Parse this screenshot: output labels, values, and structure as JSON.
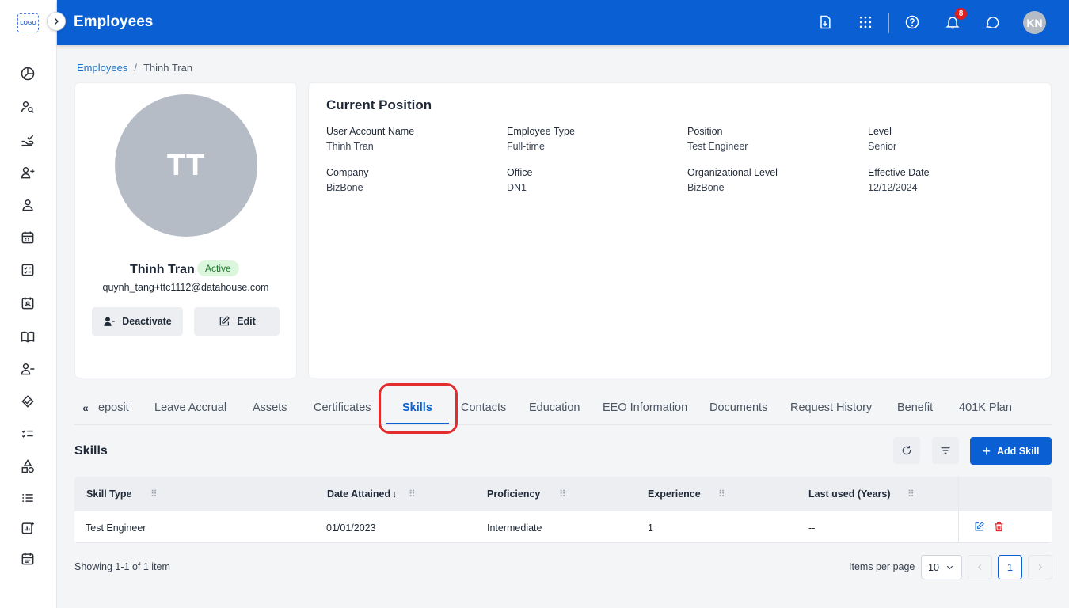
{
  "app": {
    "logo_text": "LOGO",
    "header_title": "Employees",
    "notification_count": "8",
    "user_initials": "KN"
  },
  "breadcrumb": {
    "root": "Employees",
    "separator": "/",
    "current": "Thinh Tran"
  },
  "profile": {
    "initials": "TT",
    "name": "Thinh Tran",
    "status": "Active",
    "email": "quynh_tang+ttc1112@datahouse.com",
    "deactivate_label": "Deactivate",
    "edit_label": "Edit"
  },
  "position": {
    "title": "Current Position",
    "fields": [
      {
        "label": "User Account Name",
        "value": "Thinh Tran"
      },
      {
        "label": "Employee Type",
        "value": "Full-time"
      },
      {
        "label": "Position",
        "value": "Test Engineer"
      },
      {
        "label": "Level",
        "value": "Senior"
      },
      {
        "label": "Company",
        "value": "BizBone"
      },
      {
        "label": "Office",
        "value": "DN1"
      },
      {
        "label": "Organizational Level",
        "value": "BizBone"
      },
      {
        "label": "Effective Date",
        "value": "12/12/2024"
      }
    ]
  },
  "tabs": {
    "scroll_left": "«",
    "items": [
      "eposit",
      "Leave Accrual",
      "Assets",
      "Certificates",
      "Skills",
      "Contacts",
      "Education",
      "EEO Information",
      "Documents",
      "Request History",
      "Benefit",
      "401K Plan"
    ],
    "active": "Skills"
  },
  "skills": {
    "title": "Skills",
    "add_label": "Add Skill",
    "columns": [
      "Skill Type",
      "Date Attained",
      "Proficiency",
      "Experience",
      "Last used (Years)"
    ],
    "rows": [
      {
        "skill_type": "Test Engineer",
        "date_attained": "01/01/2023",
        "proficiency": "Intermediate",
        "experience": "1",
        "last_used": "--"
      }
    ],
    "showing": "Showing 1-1 of 1 item",
    "items_per_page_label": "Items per page",
    "items_per_page": "10",
    "current_page": "1"
  },
  "colors": {
    "primary": "#0a5fd3",
    "highlight": "#e42c2c",
    "active_badge_bg": "#dcf5dd",
    "danger": "#e02424"
  }
}
